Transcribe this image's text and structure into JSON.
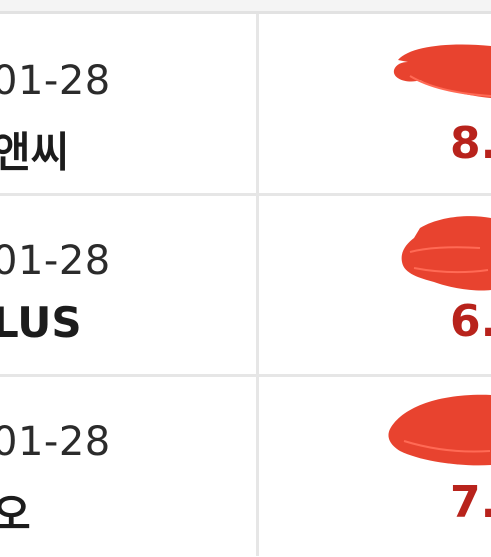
{
  "rows": [
    {
      "date": "01-28",
      "name": "앤씨",
      "price": "8."
    },
    {
      "date": "01-28",
      "name": "LUS",
      "price": "6."
    },
    {
      "date": "01-28",
      "name": "오",
      "price": "7."
    }
  ],
  "colors": {
    "price": "#b8231c",
    "redaction": "#e8432f",
    "divider": "#e6e6e6"
  }
}
